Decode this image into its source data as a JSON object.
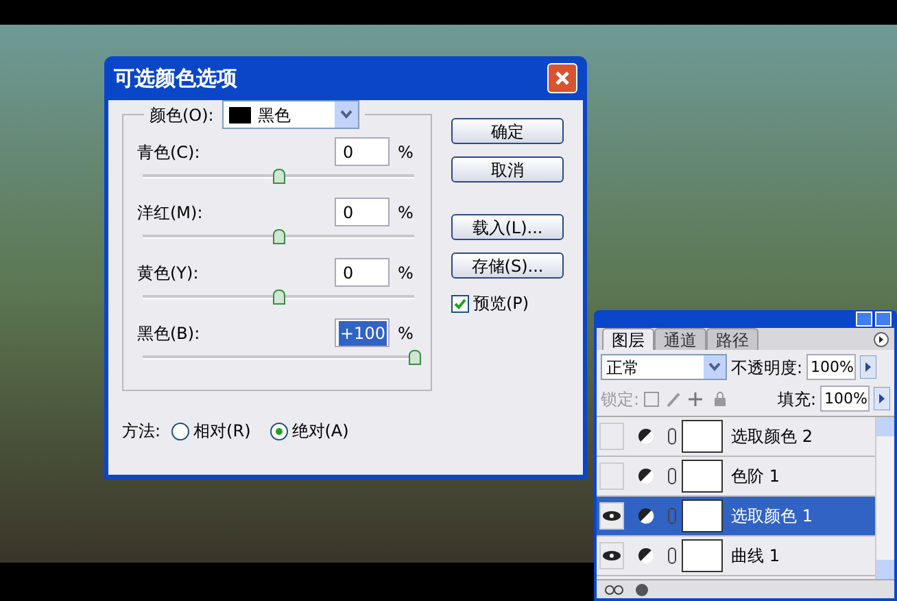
{
  "dialog": {
    "title": "可选颜色选项",
    "color_label": "颜色(O):",
    "color_value": "黑色",
    "channels": [
      {
        "label": "青色(C):",
        "value": "0",
        "unit": "%",
        "level": 0.5,
        "selected": false
      },
      {
        "label": "洋红(M):",
        "value": "0",
        "unit": "%",
        "level": 0.5,
        "selected": false
      },
      {
        "label": "黄色(Y):",
        "value": "0",
        "unit": "%",
        "level": 0.5,
        "selected": false
      },
      {
        "label": "黑色(B):",
        "value": "+100",
        "unit": "%",
        "level": 1,
        "selected": true
      }
    ],
    "buttons": [
      "确定",
      "取消",
      "载入(L)...",
      "存储(S)..."
    ],
    "preview": {
      "label": "预览(P)",
      "checked": true
    },
    "method": {
      "label": "方法:",
      "options": [
        {
          "label": "相对(R)",
          "selected": false
        },
        {
          "label": "绝对(A)",
          "selected": true
        }
      ]
    }
  },
  "layers_panel": {
    "tabs": [
      {
        "label": "图层",
        "selected": true
      },
      {
        "label": "通道",
        "selected": false
      },
      {
        "label": "路径",
        "selected": false
      }
    ],
    "blend_mode": "正常",
    "opacity_label": "不透明度:",
    "opacity": "100%",
    "lock_label": "锁定:",
    "fill_label": "填充:",
    "fill": "100%",
    "layers": [
      {
        "name": "选取颜色 2",
        "visible": false,
        "selected": false
      },
      {
        "name": "色阶 1",
        "visible": false,
        "selected": false
      },
      {
        "name": "选取颜色 1",
        "visible": true,
        "selected": true
      },
      {
        "name": "曲线 1",
        "visible": true,
        "selected": false
      }
    ]
  }
}
